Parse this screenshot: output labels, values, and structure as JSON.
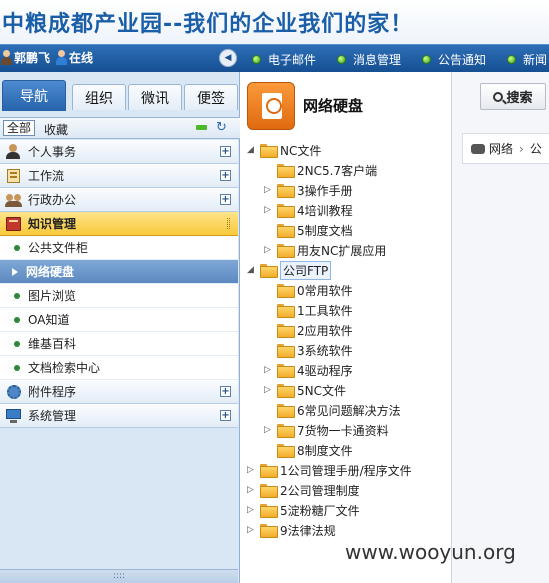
{
  "banner": {
    "title": "中粮成都产业园--我们的企业我们的家！"
  },
  "topbar": {
    "user_name": "郭鹏飞",
    "status": "在线",
    "collapse_icon": "chevron-left-icon",
    "links": [
      {
        "label": "电子邮件"
      },
      {
        "label": "消息管理"
      },
      {
        "label": "公告通知"
      },
      {
        "label": "新闻"
      }
    ]
  },
  "left": {
    "tabs": [
      {
        "label": "导航"
      },
      {
        "label": "组织"
      },
      {
        "label": "微讯"
      },
      {
        "label": "便签"
      }
    ],
    "quickbar": {
      "all": "全部",
      "favorites": "收藏"
    },
    "menu": [
      {
        "label": "个人事务",
        "icon": "person-icon"
      },
      {
        "label": "工作流",
        "icon": "workflow-icon"
      },
      {
        "label": "行政办公",
        "icon": "people-icon"
      },
      {
        "label": "知识管理",
        "icon": "book-icon"
      },
      {
        "label": "附件程序",
        "icon": "gear-icon"
      },
      {
        "label": "系统管理",
        "icon": "computer-icon"
      }
    ],
    "submenu": [
      {
        "label": "公共文件柜"
      },
      {
        "label": "网络硬盘"
      },
      {
        "label": "图片浏览"
      },
      {
        "label": "OA知道"
      },
      {
        "label": "维基百科"
      },
      {
        "label": "文档检索中心"
      }
    ],
    "bottom_grip": "::::"
  },
  "tree": {
    "title": "网络硬盘",
    "nodes": [
      {
        "label": "NC文件"
      },
      {
        "label": "2NC5.7客户端"
      },
      {
        "label": "3操作手册"
      },
      {
        "label": "4培训教程"
      },
      {
        "label": "5制度文档"
      },
      {
        "label": "用友NC扩展应用"
      },
      {
        "label": "公司FTP"
      },
      {
        "label": "0常用软件"
      },
      {
        "label": "1工具软件"
      },
      {
        "label": "2应用软件"
      },
      {
        "label": "3系统软件"
      },
      {
        "label": "4驱动程序"
      },
      {
        "label": "5NC文件"
      },
      {
        "label": "6常见问题解决方法"
      },
      {
        "label": "7货物一卡通资料"
      },
      {
        "label": "8制度文件"
      },
      {
        "label": "1公司管理手册/程序文件"
      },
      {
        "label": "2公司管理制度"
      },
      {
        "label": "5淀粉糖厂文件"
      },
      {
        "label": "9法律法规"
      }
    ]
  },
  "right": {
    "search_label": "搜索",
    "breadcrumb_root": "网络",
    "breadcrumb_next": "公"
  },
  "watermark": "www.wooyun.org"
}
